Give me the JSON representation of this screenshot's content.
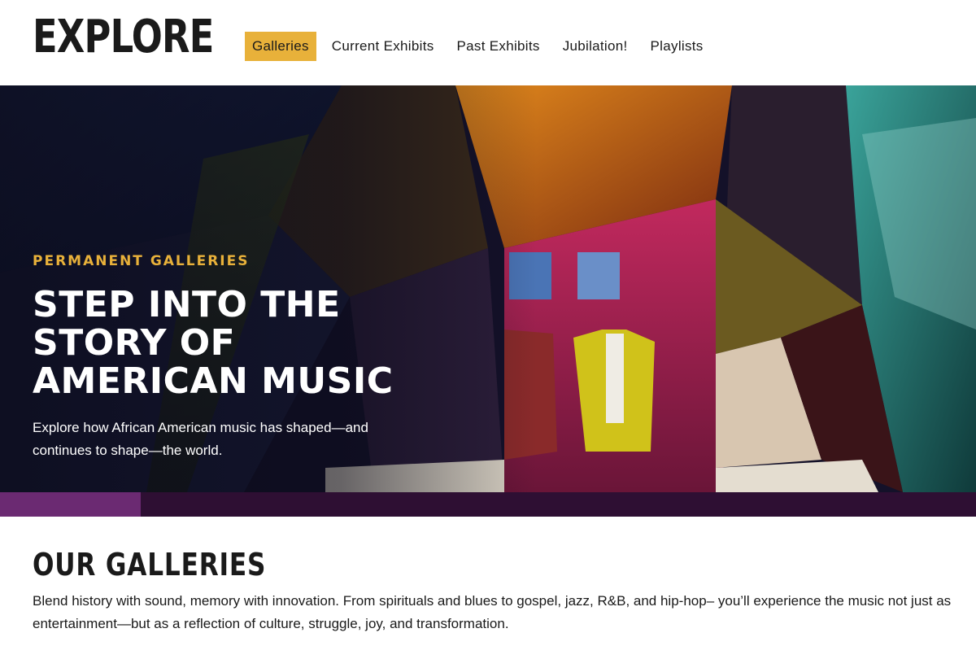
{
  "header": {
    "logo": "EXPLORE",
    "nav": [
      {
        "label": "Galleries",
        "active": true
      },
      {
        "label": "Current Exhibits",
        "active": false
      },
      {
        "label": "Past Exhibits",
        "active": false
      },
      {
        "label": "Jubilation!",
        "active": false
      },
      {
        "label": "Playlists",
        "active": false
      }
    ]
  },
  "hero": {
    "eyebrow": "PERMANENT GALLERIES",
    "title": "STEP INTO THE STORY OF AMERICAN MUSIC",
    "description": "Explore how African American music has shaped—and continues to shape—the world.",
    "progress_fraction": 0.144
  },
  "section": {
    "title": "OUR GALLERIES",
    "text": "Blend history with sound, memory with innovation. From spirituals and blues to gospel, jazz, R&B, and hip-hop– you’ll experience the music not just as entertainment—but as a reflection of culture, struggle, joy, and transformation."
  },
  "colors": {
    "accent": "#e8b13a",
    "progress_track": "#2e0f33",
    "progress_fill": "#6b2a72"
  }
}
